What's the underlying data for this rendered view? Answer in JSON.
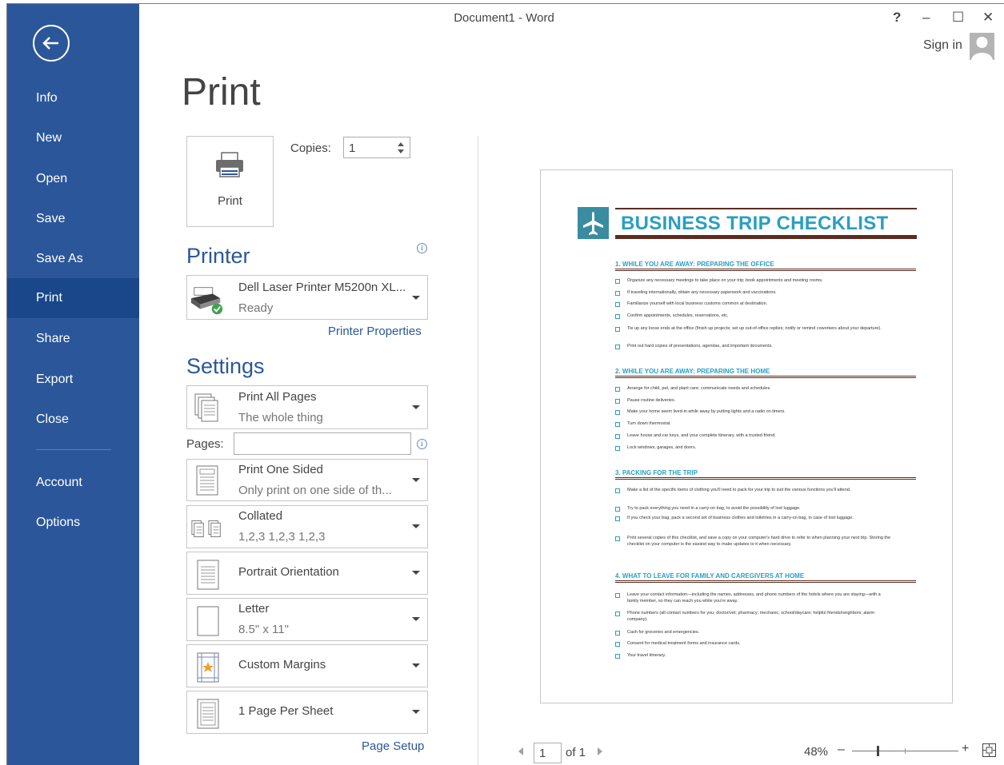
{
  "window": {
    "title": "Document1 - Word",
    "help": "?",
    "minimize": "–",
    "maximize": "☐",
    "close": "✕",
    "sign_in": "Sign in"
  },
  "nav": {
    "items": [
      "Info",
      "New",
      "Open",
      "Save",
      "Save As",
      "Print",
      "Share",
      "Export",
      "Close",
      "Account",
      "Options"
    ],
    "selected": "Print"
  },
  "page_title": "Print",
  "print_button": "Print",
  "copies": {
    "label": "Copies:",
    "value": "1"
  },
  "printer": {
    "heading": "Printer",
    "name": "Dell Laser Printer M5200n XL...",
    "status": "Ready",
    "properties_link": "Printer Properties"
  },
  "settings": {
    "heading": "Settings",
    "print_range": {
      "title": "Print All Pages",
      "sub": "The whole thing"
    },
    "pages_label": "Pages:",
    "pages_value": "",
    "sides": {
      "title": "Print One Sided",
      "sub": "Only print on one side of th..."
    },
    "collation": {
      "title": "Collated",
      "sub": "1,2,3    1,2,3    1,2,3"
    },
    "orientation": {
      "title": "Portrait Orientation"
    },
    "paper": {
      "title": "Letter",
      "sub": "8.5\" x 11\""
    },
    "margins": {
      "title": "Custom Margins"
    },
    "per_sheet": {
      "title": "1 Page Per Sheet"
    },
    "page_setup_link": "Page Setup"
  },
  "info_icon_glyph": "i",
  "preview": {
    "title": "BUSINESS TRIP CHECKLIST",
    "sections": [
      {
        "heading": "1.  WHILE YOU ARE AWAY: PREPARING THE OFFICE",
        "items": [
          "Organize any necessary meetings to take place on your trip; book appointments and meeting rooms.",
          "If traveling internationally, obtain any necessary paperwork and vaccinations.",
          "Familiarize yourself with local business customs common at destination.",
          "Confirm appointments, schedules, reservations, etc.",
          "Tie up any loose ends at the office (finish up projects; set up out-of-office replies; notify or remind coworkers about your departure).",
          "Print out hard copies of presentations, agendas, and important documents."
        ]
      },
      {
        "heading": "2.  WHILE YOU ARE AWAY: PREPARING THE HOME",
        "items": [
          "Arrange for child, pet, and plant care; communicate needs and schedules.",
          "Pause routine deliveries.",
          "Make your home seem lived-in while away by putting lights and a radio on timers.",
          "Turn down thermostat.",
          "Leave house and car keys, and your complete itinerary, with a trusted friend.",
          "Lock windows, garages, and doors."
        ]
      },
      {
        "heading": "3.  PACKING FOR THE TRIP",
        "items": [
          "Make a list of the specific items of clothing you'll need to pack for your trip to suit the various functions you'll attend.",
          "Try to pack everything you need in a carry-on bag, to avoid the possibility of lost luggage.",
          "If you check your bag, pack a second set of business clothes and toiletries in a carry-on bag, in case of lost luggage.",
          "Print several copies of this checklist, and save a copy on your computer's hard drive to refer to when planning your next trip. Storing the checklist on your computer is the easiest way to make updates to it when necessary."
        ]
      },
      {
        "heading": "4.  WHAT TO LEAVE FOR FAMILY AND CAREGIVERS AT HOME",
        "items": [
          "Leave your contact information—including the names, addresses, and phone numbers of the hotels where you are staying—with a family member, so they can reach you while you're away.",
          "Phone numbers (all contact numbers for you; doctor/vet; pharmacy; mechanic; school/daycare; helpful friends/neighbors; alarm company).",
          "Cash for groceries and emergencies.",
          "Consent for medical treatment forms and insurance cards.",
          "Your travel itinerary."
        ]
      }
    ]
  },
  "pager": {
    "current": "1",
    "of": "of 1"
  },
  "zoom": {
    "value": "48%",
    "minus": "–",
    "plus": "+"
  },
  "colors": {
    "accent": "#2b579a",
    "preview_title": "#2a9fc2",
    "preview_rule": "#5b2c20"
  }
}
